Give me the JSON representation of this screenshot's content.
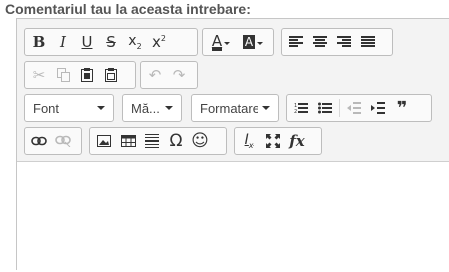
{
  "label": "Comentariul tau la aceasta intrebare:",
  "toolbar": {
    "font_combo": "Font",
    "size_combo": "Mă...",
    "format_combo": "Formatare",
    "icons": {
      "bold": "B",
      "italic": "I",
      "underline": "U",
      "strike": "S",
      "subscript": "x",
      "superscript": "x",
      "text_color": "A",
      "bg_color": "A",
      "special_char": "Ω",
      "smiley": "☺",
      "quote": "❞",
      "remove_format": "Ix",
      "formula": "fx"
    }
  },
  "colors": {
    "toolbar_bg": "#f3f3f3",
    "border": "#c6c6c6",
    "label": "#555555"
  }
}
